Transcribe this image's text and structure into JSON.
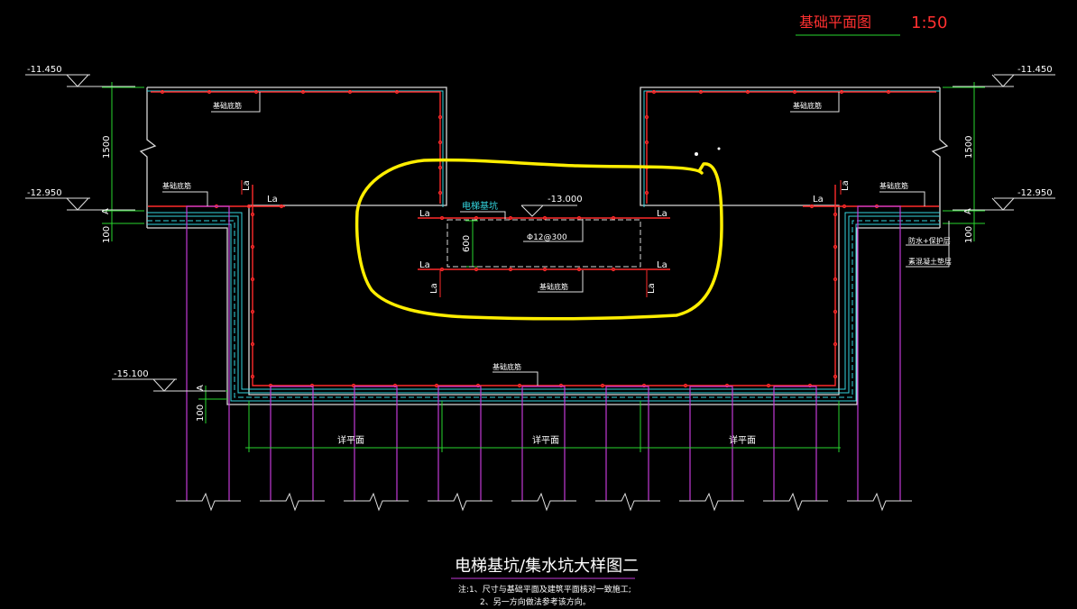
{
  "header": {
    "title": "基础平面图",
    "scale": "1:50"
  },
  "elevations": {
    "left_top": "-11.450",
    "left_mid": "-12.950",
    "left_bottom": "-15.100",
    "right_top": "-11.450",
    "right_mid": "-12.950",
    "pit_top": "-13.000"
  },
  "dimensions": {
    "h1500_left": "1500",
    "h1500_right": "1500",
    "h100_left": "100",
    "h100_right": "100",
    "h100_bottom": "100",
    "h600": "600"
  },
  "labels": {
    "section_a": "A",
    "la": "La",
    "rebar_note": "基础底筋",
    "rebar_note_b": "基础底筋",
    "pit_name": "电梯基坑",
    "rebar_spec": "Φ12@300",
    "waterproof": "防水+保护层",
    "cushion": "素混凝土垫层",
    "see_plan": "详平面"
  },
  "footer": {
    "title": "电梯基坑/集水坑大样图二",
    "note1": "注:1、尺寸与基础平面及建筑平面核对一致施工;",
    "note2": "2、另一方向做法参考该方向。"
  },
  "colors": {
    "background": "#000000",
    "title_red": "#ff3030",
    "rebar_red": "#ff2a2a",
    "concrete": "#d8d8d8",
    "cyan": "#35d6e0",
    "green": "#29d62e",
    "magenta": "#c23ad6",
    "highlight": "#ffee00"
  }
}
